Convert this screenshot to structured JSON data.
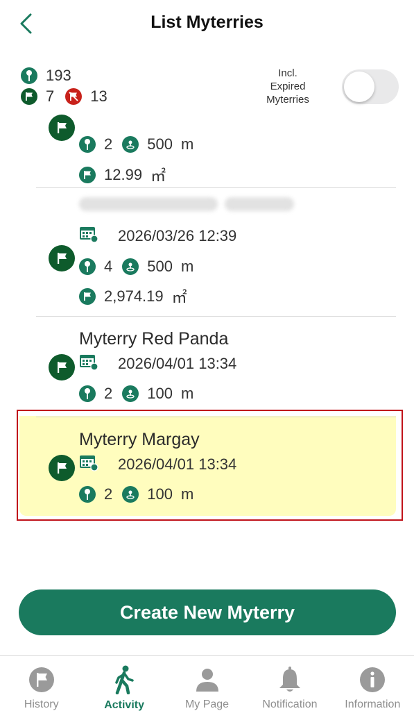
{
  "header": {
    "title": "List Myterries"
  },
  "stats": {
    "pins": "193",
    "flags": "7",
    "expired": "13"
  },
  "toggle": {
    "label_line1": "Incl.",
    "label_line2": "Expired",
    "label_line3": "Myterries",
    "on": false
  },
  "items": [
    {
      "pins": "2",
      "radius": "500",
      "radius_unit": "m",
      "area": "12.99",
      "area_unit": "㎡"
    },
    {
      "date": "2026/03/26 12:39",
      "pins": "4",
      "radius": "500",
      "radius_unit": "m",
      "area": "2,974.19",
      "area_unit": "㎡"
    },
    {
      "name": "Myterry Red Panda",
      "date": "2026/04/01 13:34",
      "pins": "2",
      "radius": "100",
      "radius_unit": "m"
    },
    {
      "name": "Myterry Margay",
      "date": "2026/04/01 13:34",
      "pins": "2",
      "radius": "100",
      "radius_unit": "m",
      "highlighted": true
    }
  ],
  "create_button": {
    "label": "Create New Myterry"
  },
  "tabs": [
    {
      "label": "History",
      "icon": "flag-icon",
      "active": false
    },
    {
      "label": "Activity",
      "icon": "walking-person-icon",
      "active": true
    },
    {
      "label": "My Page",
      "icon": "person-icon",
      "active": false
    },
    {
      "label": "Notification",
      "icon": "bell-icon",
      "active": false
    },
    {
      "label": "Information",
      "icon": "info-icon",
      "active": false
    }
  ],
  "colors": {
    "brand": "#1a7a5e",
    "flag_dark": "#0e5b2c",
    "expired_red": "#c8221b",
    "highlight_bg": "#fffdbe",
    "highlight_border": "#c0131a"
  }
}
